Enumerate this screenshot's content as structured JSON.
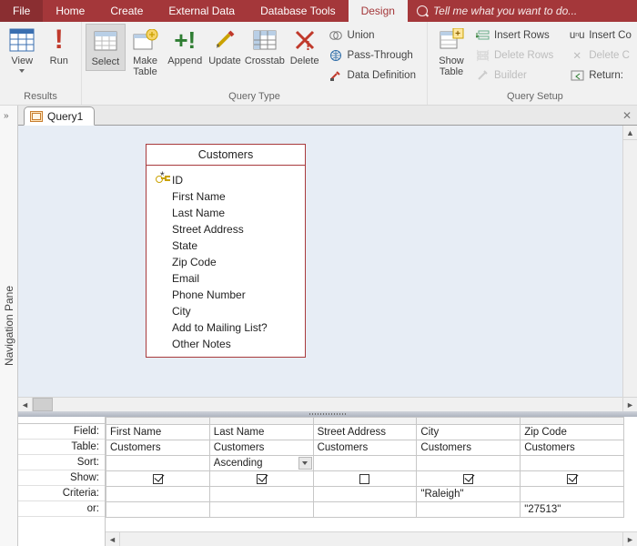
{
  "tabs": {
    "file": "File",
    "home": "Home",
    "create": "Create",
    "external": "External Data",
    "dbtools": "Database Tools",
    "design": "Design",
    "tellme": "Tell me what you want to do..."
  },
  "ribbon": {
    "results": {
      "view": "View",
      "run": "Run",
      "label": "Results"
    },
    "querytype": {
      "select": "Select",
      "maketable": "Make\nTable",
      "append": "Append",
      "update": "Update",
      "crosstab": "Crosstab",
      "delete": "Delete",
      "union": "Union",
      "passthrough": "Pass-Through",
      "datadef": "Data Definition",
      "label": "Query Type"
    },
    "setup": {
      "showtable": "Show\nTable",
      "insertrows": "Insert Rows",
      "deleterows": "Delete Rows",
      "builder": "Builder",
      "insertcols": "Insert Co",
      "deletecols": "Delete C",
      "return": "Return:",
      "label": "Query Setup"
    }
  },
  "navpane": "Navigation Pane",
  "doc": {
    "tab": "Query1"
  },
  "tablebox": {
    "title": "Customers",
    "fields": [
      "*",
      "ID",
      "First Name",
      "Last Name",
      "Street Address",
      "State",
      "Zip Code",
      "Email",
      "Phone Number",
      "City",
      "Add to Mailing List?",
      "Other Notes"
    ]
  },
  "gridrows": {
    "field": "Field:",
    "table": "Table:",
    "sort": "Sort:",
    "show": "Show:",
    "criteria": "Criteria:",
    "or": "or:"
  },
  "gridcols": [
    {
      "field": "First Name",
      "table": "Customers",
      "sort": "",
      "show": true,
      "criteria": "",
      "or": ""
    },
    {
      "field": "Last Name",
      "table": "Customers",
      "sort": "Ascending",
      "sortdd": true,
      "show": true,
      "criteria": "",
      "or": ""
    },
    {
      "field": "Street Address",
      "table": "Customers",
      "sort": "",
      "show": false,
      "criteria": "",
      "or": ""
    },
    {
      "field": "City",
      "table": "Customers",
      "sort": "",
      "show": true,
      "criteria": "\"Raleigh\"",
      "or": ""
    },
    {
      "field": "Zip Code",
      "table": "Customers",
      "sort": "",
      "show": true,
      "criteria": "",
      "or": "\"27513\""
    }
  ]
}
